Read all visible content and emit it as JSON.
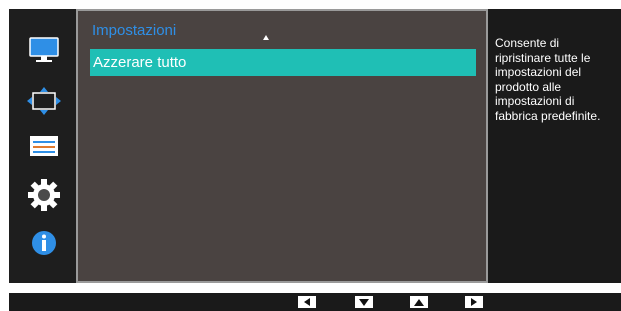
{
  "sidebar": {
    "icons": [
      "picture-icon",
      "screen-adjust-icon",
      "osd-settings-icon",
      "system-gear-icon",
      "information-icon"
    ],
    "active_color": "#2f8fe6"
  },
  "panel": {
    "title": "Impostazioni",
    "items": [
      {
        "label": "Azzerare tutto",
        "selected": true
      }
    ]
  },
  "description": {
    "text": "Consente di ripristinare tutte le impostazioni del prodotto alle impostazioni di fabbrica predefinite."
  },
  "navigation": {
    "buttons": [
      "arrow-left",
      "arrow-down",
      "arrow-up",
      "arrow-right"
    ]
  },
  "colors": {
    "title": "#2f8fe6",
    "selection": "#1fbfb5",
    "panel_bg": "#4a4341"
  }
}
